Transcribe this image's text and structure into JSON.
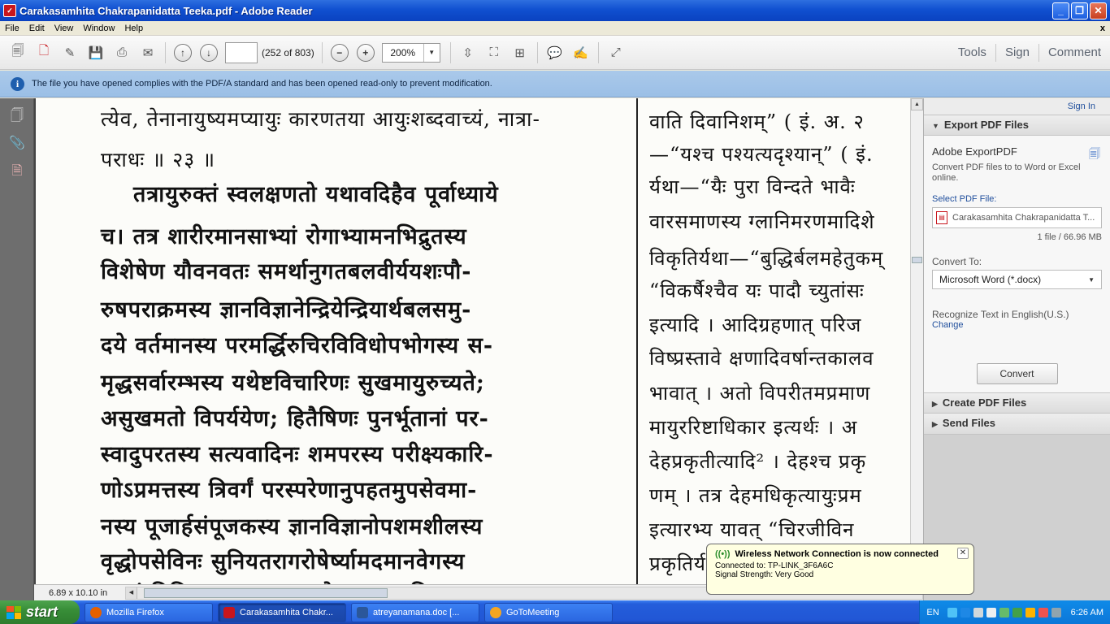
{
  "window": {
    "title": "Carakasamhita Chakrapanidatta Teeka.pdf - Adobe Reader",
    "minimize_label": "_",
    "restore_label": "❐",
    "close_label": "✕"
  },
  "menu": {
    "items": [
      "File",
      "Edit",
      "View",
      "Window",
      "Help"
    ],
    "close_doc": "x"
  },
  "toolbar": {
    "page_input_value": "",
    "page_count": "(252 of 803)",
    "zoom_value": "200%",
    "tabs": [
      "Tools",
      "Sign",
      "Comment"
    ]
  },
  "infobar": {
    "message": "The file you have opened complies with the PDF/A standard and has been opened read-only to prevent modification."
  },
  "document": {
    "col1_lines": [
      "त्येव, तेनानायुष्यमप्यायुः कारणतया आयुःशब्दवाच्यं, नात्रा-",
      "पराधः ॥ २३ ॥",
      "तत्रायुरुक्तं स्वलक्षणतो यथावदिहैव पूर्वाध्याये",
      "च। तत्र शारीरमानसाभ्यां रोगाभ्यामनभिद्रुतस्य",
      "विशेषेण यौवनवतः समर्थानुगतबलवीर्ययशःपौ-",
      "रुषपराक्रमस्य ज्ञानविज्ञानेन्द्रियेन्द्रियार्थबलसमु-",
      "दये वर्तमानस्य परमर्द्धिरुचिरविविधोपभोगस्य स-",
      "मृद्धसर्वारम्भस्य यथेष्टविचारिणः सुखमायुरुच्यते;",
      "असुखमतो विपर्ययेण; हितैषिणः पुनर्भूतानां पर-",
      "स्वादुपरतस्य सत्यवादिनः शमपरस्य परीक्ष्यकारि-",
      "णोऽप्रमत्तस्य त्रिवर्गं परस्परेणानुपहतमुपसेवमा-",
      "नस्य पूजार्हसंपूजकस्य ज्ञानविज्ञानोपशमशीलस्य",
      "वृद्धोपसेविनः सुनियतरागरोषेर्ष्यामदमानवेगस्य",
      "सततं विविधप्रदानपरस्य तपोज्ञानप्रशमनित्यस्या-"
    ],
    "col2_lines": [
      "वाति दिवानिशम्” ( इं. अ. २",
      "—“यश्च पश्यत्यदृश्यान्” ( इं.",
      "र्यथा—“यैः पुरा विन्दते भावैः",
      "वारसमाणस्य ग्लानिमरणमादिशे",
      "विकृतिर्यथा—“बुद्धिर्बलमहेतुकम्",
      "“विकर्षैश्चैव यः पादौ च्युतांसः",
      "इत्यादि । आदिग्रहणात् परिज",
      "विष्प्रस्तावे क्षणादिवर्षान्तकालव",
      "भावात् । अतो विपरीतमप्रमाण",
      "मायुररिष्टाधिकार इत्यर्थः । अ",
      "देहप्रकृतीत्यादि² । देहश्च प्रकृ",
      "णम् । तत्र देहमधिकृत्यायुःप्रम",
      "इत्यारभ्य यावत् “चिरजीविन",
      "प्रकृतिर्यथा—“सत्त्ववान् सहः"
    ],
    "page_size": "6.89 x 10.10 in"
  },
  "right_panel": {
    "sign_in": "Sign In",
    "export_header": "Export PDF Files",
    "export_title": "Adobe ExportPDF",
    "export_desc": "Convert PDF files to to Word or Excel online.",
    "select_label": "Select PDF File:",
    "selected_file": "Carakasamhita Chakrapanidatta T...",
    "file_count": "1 file / 66.96 MB",
    "convert_to_label": "Convert To:",
    "convert_to_value": "Microsoft Word (*.docx)",
    "recognize": "Recognize Text in English(U.S.)",
    "change": "Change",
    "convert_button": "Convert",
    "create_header": "Create PDF Files",
    "send_header": "Send Files"
  },
  "notification": {
    "title": "Wireless Network Connection is now connected",
    "connected_to": "Connected to: TP-LINK_3F6A6C",
    "signal": "Signal Strength: Very Good"
  },
  "taskbar": {
    "start_label": "start",
    "items": [
      {
        "label": "Mozilla Firefox",
        "color": "#e66000"
      },
      {
        "label": "Carakasamhita Chakr...",
        "color": "#c8161d"
      },
      {
        "label": "atreyanamana.doc [...",
        "color": "#2b579a"
      },
      {
        "label": "GoToMeeting",
        "color": "#f5a623"
      }
    ],
    "lang": "EN",
    "clock": "6:26 AM"
  }
}
